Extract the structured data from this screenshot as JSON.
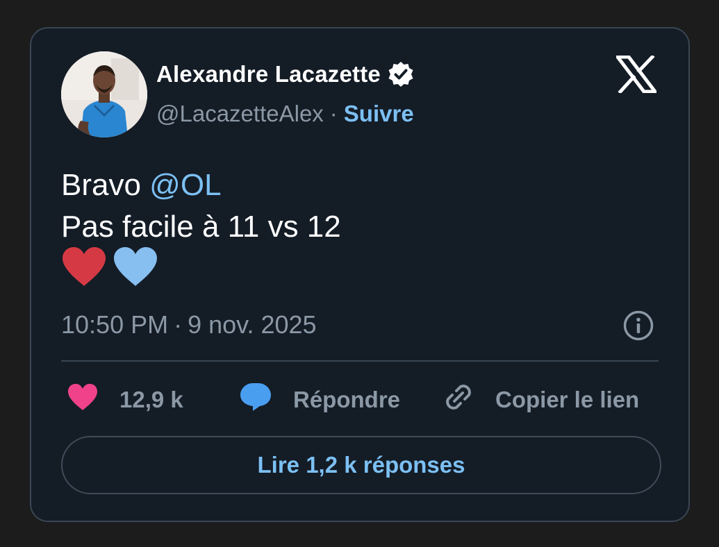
{
  "author": {
    "display_name": "Alexandre Lacazette",
    "handle": "@LacazetteAlex",
    "separator": "·",
    "follow_label": "Suivre",
    "verified": true
  },
  "tweet": {
    "text_line1_prefix": "Bravo ",
    "mention": "@OL",
    "text_line2": "Pas facile à 11 vs 12",
    "emojis": [
      "red-heart",
      "blue-heart"
    ]
  },
  "meta": {
    "time": "10:50 PM",
    "separator": "·",
    "date": "9 nov. 2025"
  },
  "actions": {
    "like_count": "12,9 k",
    "reply_label": "Répondre",
    "copy_link_label": "Copier le lien"
  },
  "read_replies_label": "Lire 1,2 k réponses",
  "colors": {
    "background": "#1c1c1c",
    "card": "#141c26",
    "border": "#3a4654",
    "accent_blue": "#7cc0f3",
    "muted_text": "#8b98a5",
    "like_pink": "#f0428a",
    "reply_blue": "#4a9ef0",
    "red_heart": "#d53a44",
    "blue_heart": "#86bff0"
  },
  "icons": [
    "x-logo-icon",
    "verified-badge-icon",
    "info-icon",
    "heart-icon",
    "reply-bubble-icon",
    "link-icon"
  ]
}
